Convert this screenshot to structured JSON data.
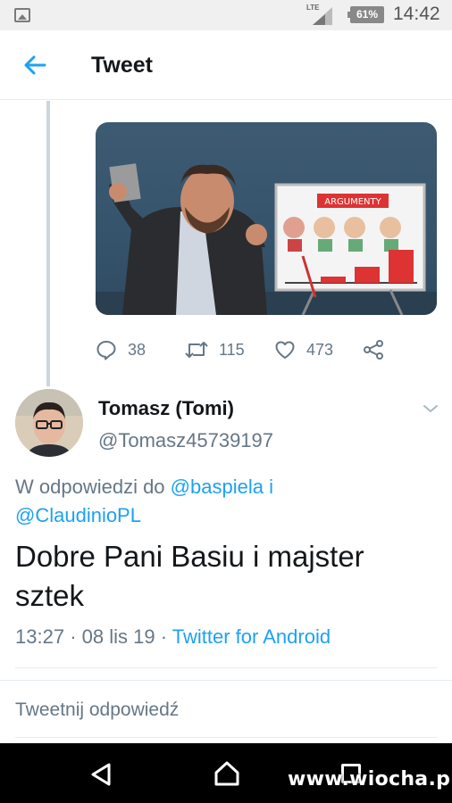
{
  "status_bar": {
    "network": "LTE",
    "battery": "61%",
    "time": "14:42",
    "icons": [
      "gallery-icon",
      "signal-icon",
      "battery-icon"
    ]
  },
  "header": {
    "back_icon": "arrow-left-icon",
    "title": "Tweet"
  },
  "parent_tweet": {
    "media_sign_text": "ARGUMENTY",
    "actions": {
      "reply_count": "38",
      "retweet_count": "115",
      "like_count": "473",
      "icons": [
        "reply-icon",
        "retweet-icon",
        "like-icon",
        "share-icon"
      ]
    }
  },
  "reply_tweet": {
    "name": "Tomasz (Tomi)",
    "handle": "@Tomasz45739197",
    "reply_prefix": "W odpowiedzi do",
    "mention_1": "@baspiela",
    "conjunction": "i",
    "mention_2": "@ClaudinioPL",
    "text": "Dobre Pani Basiu i majster sztek",
    "time": "13:27",
    "date": "08 lis 19",
    "separator": "·",
    "client": "Twitter for Android"
  },
  "reply_box": {
    "placeholder": "Tweetnij odpowiedź"
  },
  "nav_bar": {
    "watermark": "www.wiocha.pl",
    "icons": [
      "nav-back-icon",
      "nav-home-icon",
      "nav-recents-icon"
    ]
  },
  "colors": {
    "accent": "#1da1f2",
    "secondary_text": "#657786",
    "primary_text": "#14171a"
  }
}
